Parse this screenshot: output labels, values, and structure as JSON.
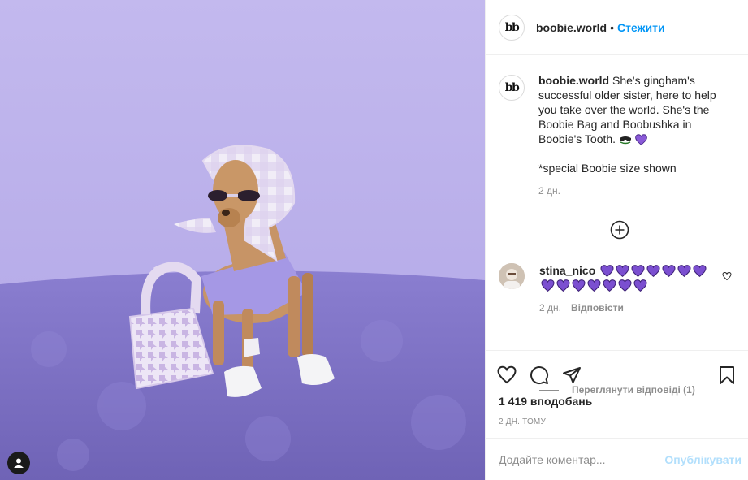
{
  "post": {
    "author": {
      "username": "boobie.world",
      "avatar_text": "bb"
    },
    "follow_label": "Стежити",
    "separator": "•",
    "caption": {
      "text": "She's gingham's successful older sister, here to help you take over the world. She's the Boobie Bag and Boobushka in Boobie's Tooth.",
      "note": "*special Boobie size shown",
      "time": "2 дн."
    },
    "comment": {
      "username": "stina_nico",
      "hearts_count": 14,
      "heart_color": "#7b4fd0",
      "time": "2 дн.",
      "reply_label": "Відповісти",
      "view_replies_label": "Переглянути відповіді (1)"
    },
    "likes_text": "1 419 вподобань",
    "timestamp": "2 ДН. ТОМУ",
    "add_comment_placeholder": "Додайте коментар...",
    "publish_label": "Опублікувати"
  },
  "icons": {
    "tag": "user-tag-icon",
    "more": "plus-circle-icon",
    "like": "heart-outline-icon",
    "comment": "comment-bubble-icon",
    "share": "paper-plane-icon",
    "save": "bookmark-icon"
  },
  "colors": {
    "accent": "#0095f6",
    "publish_disabled": "#b2dffc",
    "muted": "#8e8e8e",
    "photo_wall": "#b3a7e3",
    "photo_rug": "#7b6fc4"
  }
}
